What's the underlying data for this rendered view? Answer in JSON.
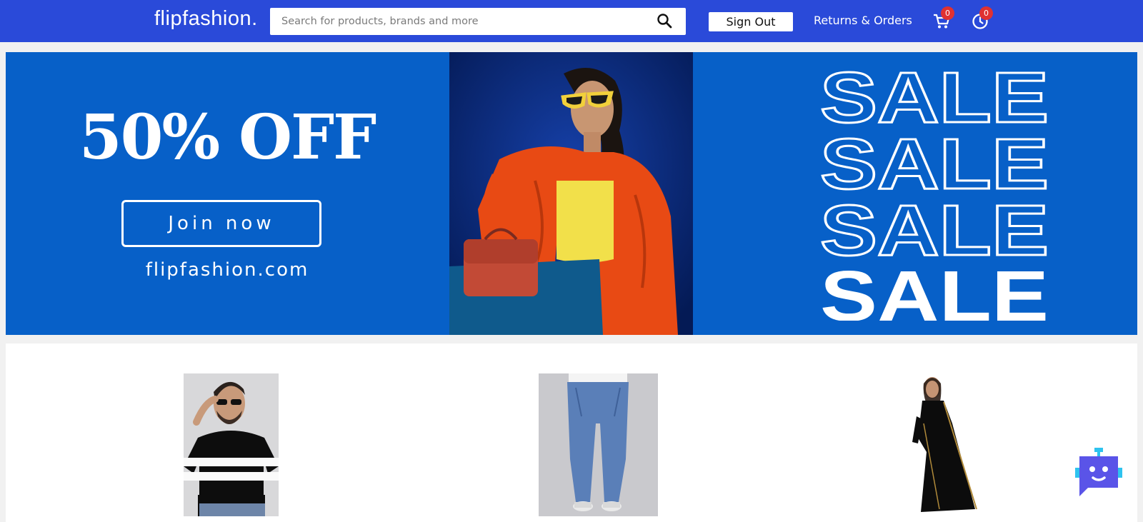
{
  "header": {
    "logo": "flipfashion.",
    "search": {
      "placeholder": "Search for products, brands and more",
      "value": ""
    },
    "sign_out_label": "Sign Out",
    "returns_label": "Returns & Orders",
    "cart_count": "0",
    "history_count": "0",
    "icons": {
      "search": "search-icon",
      "cart": "cart-icon",
      "history": "clock-icon"
    }
  },
  "banner": {
    "headline": "50% OFF",
    "join_label": "Join now",
    "site": "flipfashion.com",
    "sale_words": [
      "SALE",
      "SALE",
      "SALE",
      "SALE"
    ]
  },
  "products": [
    {
      "image": "man-striped-tshirt"
    },
    {
      "image": "blue-jeans"
    },
    {
      "image": "black-saree"
    }
  ],
  "chatbot": {
    "icon": "robot-chat-icon"
  },
  "colors": {
    "header": "#2a4ad9",
    "banner": "#0760c8",
    "badge": "#e03131",
    "bot": "#5a54e8"
  }
}
